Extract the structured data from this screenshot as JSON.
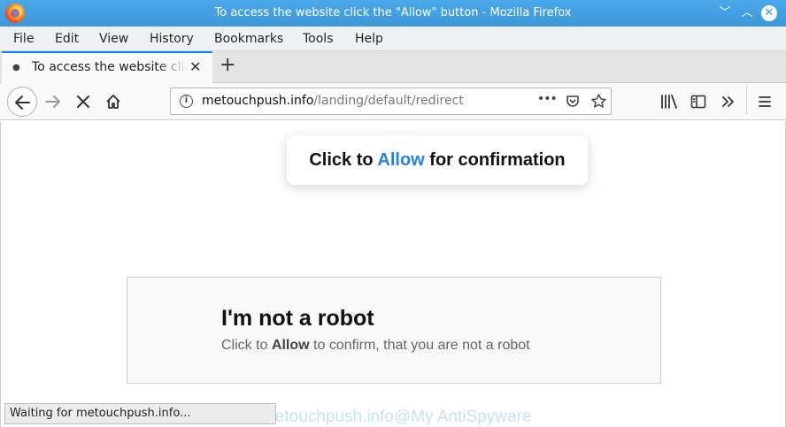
{
  "window": {
    "title": "To access the website click the \"Allow\" button - Mozilla Firefox",
    "controls": {
      "minimize": "﹀",
      "maximize": "︿",
      "close": "✕"
    }
  },
  "menu": [
    "File",
    "Edit",
    "View",
    "History",
    "Bookmarks",
    "Tools",
    "Help"
  ],
  "tab": {
    "title": "To access the website click the \"Allow\" button",
    "close": "✕",
    "new_tab": "+"
  },
  "navbar": {
    "url_domain": "metouchpush.info",
    "url_path": "/landing/default/redirect",
    "page_actions": "•••"
  },
  "page": {
    "popup": {
      "prefix": "Click to ",
      "allow": "Allow",
      "suffix": " for confirmation"
    },
    "robot": {
      "heading": "I'm not a robot",
      "sub_prefix": "Click to ",
      "sub_bold": "Allow",
      "sub_suffix": " to confirm, that you are not a robot"
    }
  },
  "status": "Waiting for metouchpush.info...",
  "watermark": "Metouchpush.info@My AntiSpyware",
  "colors": {
    "accent": "#0a84ff",
    "allow": "#2a7fe0",
    "titlebar": "#3d97d8"
  }
}
